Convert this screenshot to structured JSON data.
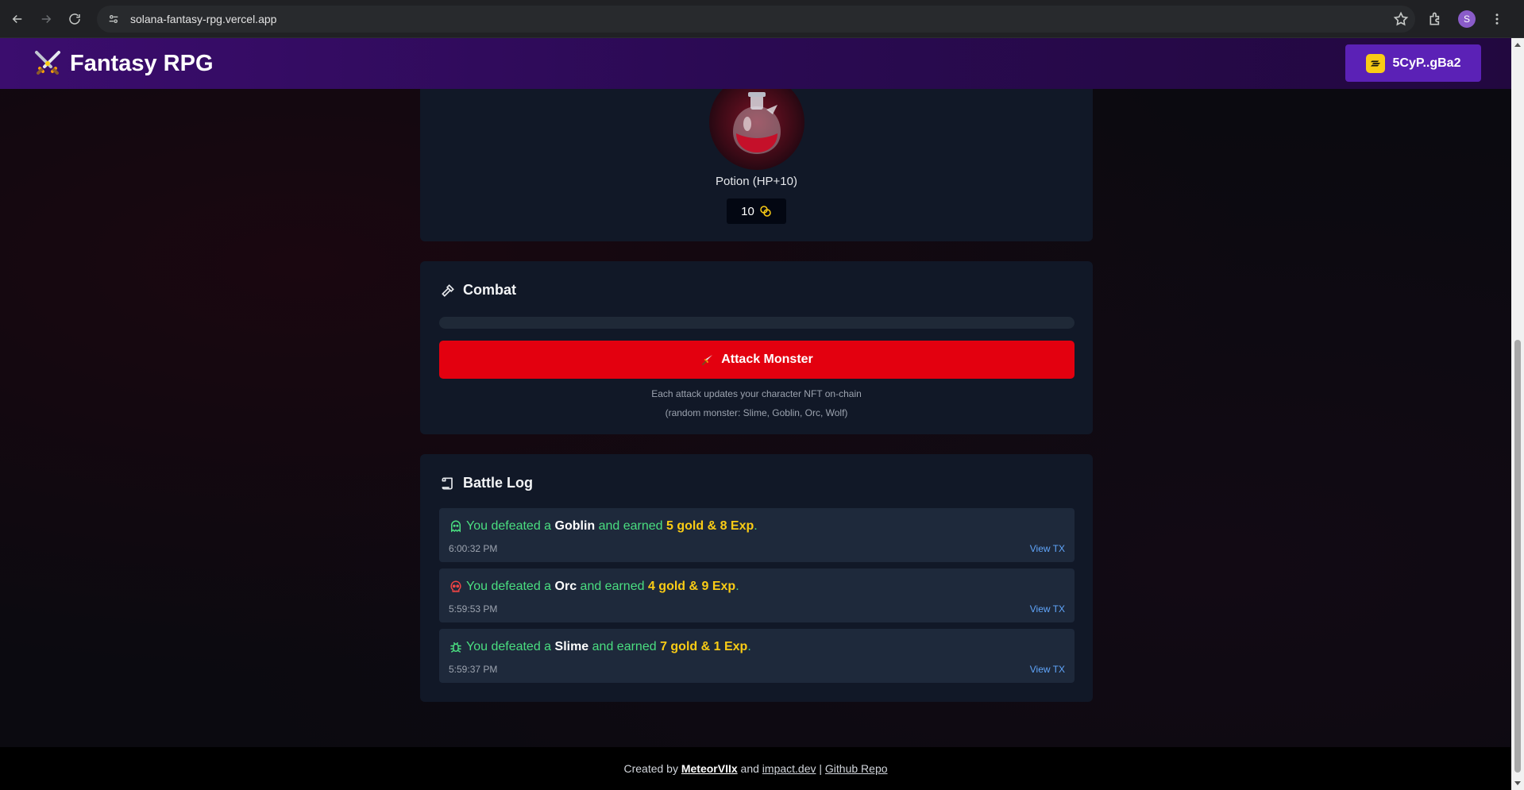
{
  "browser": {
    "url": "solana-fantasy-rpg.vercel.app",
    "profile_initial": "S"
  },
  "header": {
    "title": "Fantasy RPG",
    "wallet_label": "5CyP..gBa2"
  },
  "shop": {
    "item_name": "Potion (HP+10)",
    "item_price": "10"
  },
  "combat": {
    "title": "Combat",
    "progress_percent": 0,
    "attack_label": "Attack Monster",
    "hint_1": "Each attack updates your character NFT on-chain",
    "hint_2": "(random monster: Slime, Goblin, Orc, Wolf)"
  },
  "battle_log": {
    "title": "Battle Log",
    "entries": [
      {
        "prefix": "You defeated a ",
        "monster": "Goblin",
        "middle": " and earned ",
        "reward": "5 gold & 8 Exp",
        "suffix": ".",
        "time": "6:00:32 PM",
        "link": "View TX",
        "icon": "ghost-icon",
        "icon_color": "#4ade80"
      },
      {
        "prefix": "You defeated a ",
        "monster": "Orc",
        "middle": " and earned ",
        "reward": "4 gold & 9 Exp",
        "suffix": ".",
        "time": "5:59:53 PM",
        "link": "View TX",
        "icon": "skull-icon",
        "icon_color": "#ef4444"
      },
      {
        "prefix": "You defeated a ",
        "monster": "Slime",
        "middle": " and earned ",
        "reward": "7 gold & 1 Exp",
        "suffix": ".",
        "time": "5:59:37 PM",
        "link": "View TX",
        "icon": "bug-icon",
        "icon_color": "#4ade80"
      }
    ]
  },
  "footer": {
    "created_by": "Created by ",
    "author": "MeteorVIIx",
    "and": " and ",
    "partner": "impact.dev",
    "sep": " | ",
    "repo": "Github Repo"
  },
  "colors": {
    "header_gradient_start": "#3b0d6e",
    "wallet_button": "#5b21b6",
    "attack_button": "#e3000f",
    "card_bg": "#111827",
    "log_entry_bg": "#1e293b",
    "success_text": "#4ade80",
    "reward_text": "#facc15",
    "link_text": "#60a5fa"
  }
}
